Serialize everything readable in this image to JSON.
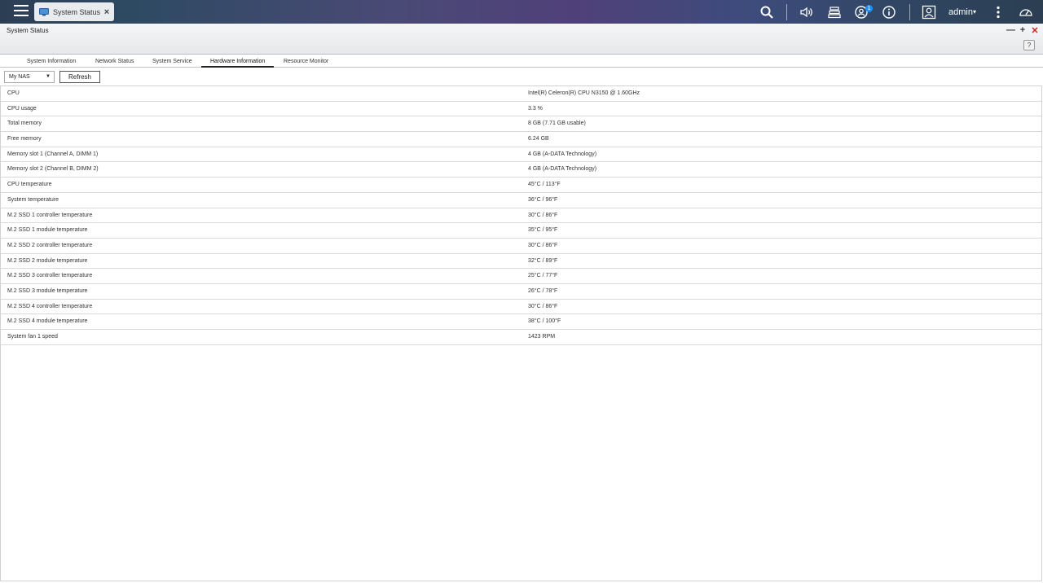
{
  "topbar": {
    "app_tab_label": "System Status",
    "app_tab_close": "×",
    "notification_count": "1",
    "user_name": "admin",
    "user_caret": "▾"
  },
  "window": {
    "title": "System Status",
    "minimize": "—",
    "maximize": "+",
    "close": "✕",
    "help": "?"
  },
  "tabs": [
    {
      "label": "System Information"
    },
    {
      "label": "Network Status"
    },
    {
      "label": "System Service"
    },
    {
      "label": "Hardware Information"
    },
    {
      "label": "Resource Monitor"
    }
  ],
  "active_tab": "Hardware Information",
  "toolbar": {
    "nas_select_value": "My NAS",
    "refresh_label": "Refresh"
  },
  "hardware": [
    {
      "key": "CPU",
      "value": "Intel(R) Celeron(R) CPU N3150 @ 1.60GHz"
    },
    {
      "key": "CPU usage",
      "value": "3.3 %"
    },
    {
      "key": "Total memory",
      "value": "8 GB (7.71 GB usable)"
    },
    {
      "key": "Free memory",
      "value": "6.24 GB"
    },
    {
      "key": "Memory slot 1 (Channel A, DIMM 1)",
      "value": "4 GB (A-DATA Technology)"
    },
    {
      "key": "Memory slot 2 (Channel B, DIMM 2)",
      "value": "4 GB (A-DATA Technology)"
    },
    {
      "key": "CPU temperature",
      "value": "45°C / 113°F"
    },
    {
      "key": "System temperature",
      "value": "36°C / 96°F"
    },
    {
      "key": "M.2 SSD 1 controller temperature",
      "value": "30°C / 86°F"
    },
    {
      "key": "M.2 SSD 1 module temperature",
      "value": "35°C / 95°F"
    },
    {
      "key": "M.2 SSD 2 controller temperature",
      "value": "30°C / 86°F"
    },
    {
      "key": "M.2 SSD 2 module temperature",
      "value": "32°C / 89°F"
    },
    {
      "key": "M.2 SSD 3 controller temperature",
      "value": "25°C / 77°F"
    },
    {
      "key": "M.2 SSD 3 module temperature",
      "value": "26°C / 78°F"
    },
    {
      "key": "M.2 SSD 4 controller temperature",
      "value": "30°C / 86°F"
    },
    {
      "key": "M.2 SSD 4 module temperature",
      "value": "38°C / 100°F"
    },
    {
      "key": "System fan 1 speed",
      "value": "1423 RPM"
    }
  ],
  "colors": {
    "accent": "#1e90ff",
    "close": "#d32020"
  }
}
